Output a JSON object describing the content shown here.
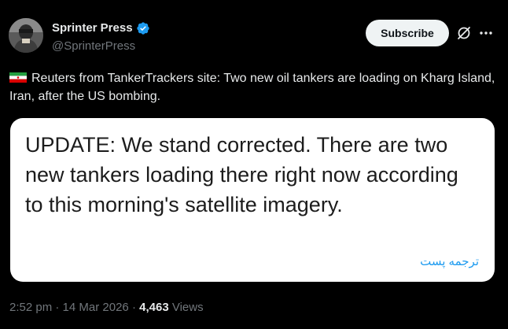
{
  "author": {
    "display_name": "Sprinter Press",
    "handle": "@SprinterPress",
    "verified": true,
    "avatar_icon": "avatar-person-icon"
  },
  "header": {
    "subscribe_label": "Subscribe",
    "grok_icon": "grok-icon",
    "more_icon": "more-icon"
  },
  "tweet": {
    "flag_icon": "iran-flag-icon",
    "text": "Reuters from TankerTrackers site: Two new oil tankers are loading on Kharg Island, Iran, after the US bombing."
  },
  "quote_image": {
    "text": "UPDATE: We stand corrected. There are two new tankers loading there right now according to this morning's satellite imagery.",
    "translate_label": "ترجمه پست"
  },
  "meta": {
    "time": "2:52 pm",
    "date": "14 Mar 2026",
    "separator": " · ",
    "views_count": "4,463",
    "views_label": "Views"
  },
  "colors": {
    "background": "#000000",
    "text_primary": "#e7e9ea",
    "text_secondary": "#71767b",
    "accent": "#1d9bf0",
    "button_bg": "#eff3f4"
  }
}
